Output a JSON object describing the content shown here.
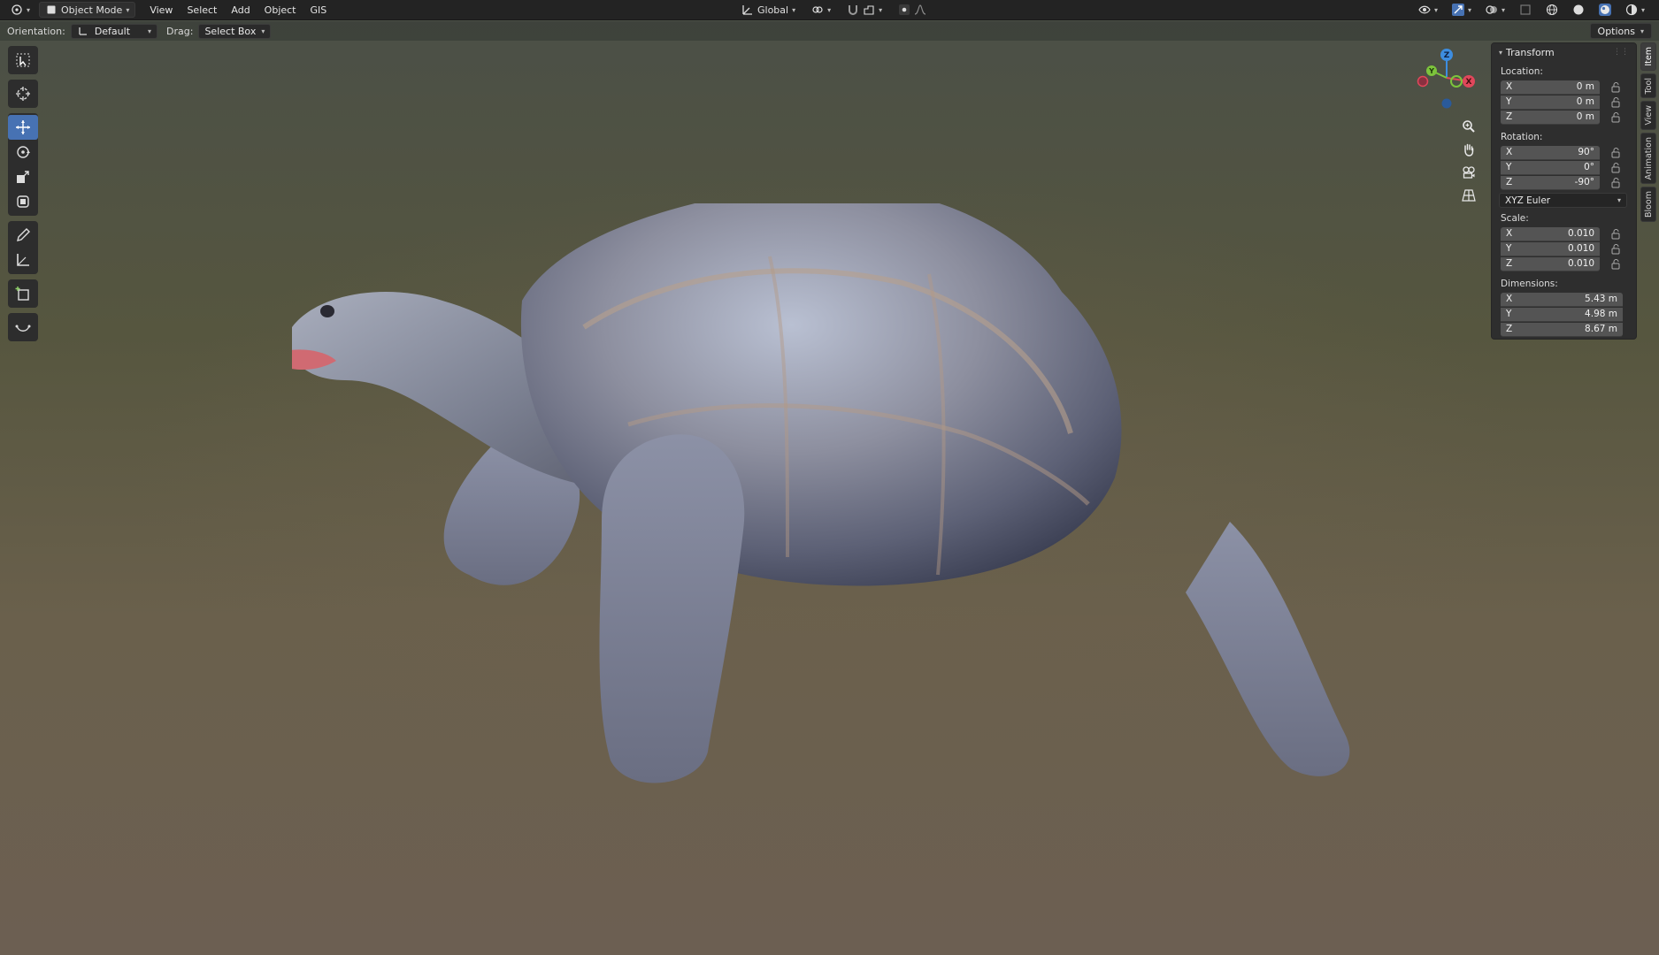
{
  "header": {
    "mode": "Object Mode",
    "menus": [
      "View",
      "Select",
      "Add",
      "Object",
      "GIS"
    ],
    "transform_orientation": "Global"
  },
  "tool_settings": {
    "orientation_label": "Orientation:",
    "orientation_value": "Default",
    "drag_label": "Drag:",
    "drag_value": "Select Box",
    "options_label": "Options"
  },
  "gizmo": {
    "axis_x": "X",
    "axis_y": "Y",
    "axis_z": "Z"
  },
  "transform_panel": {
    "title": "Transform",
    "location": {
      "label": "Location:",
      "rows": [
        {
          "axis": "X",
          "value": "0 m"
        },
        {
          "axis": "Y",
          "value": "0 m"
        },
        {
          "axis": "Z",
          "value": "0 m"
        }
      ]
    },
    "rotation": {
      "label": "Rotation:",
      "rows": [
        {
          "axis": "X",
          "value": "90°"
        },
        {
          "axis": "Y",
          "value": "0°"
        },
        {
          "axis": "Z",
          "value": "-90°"
        }
      ],
      "mode": "XYZ Euler"
    },
    "scale": {
      "label": "Scale:",
      "rows": [
        {
          "axis": "X",
          "value": "0.010"
        },
        {
          "axis": "Y",
          "value": "0.010"
        },
        {
          "axis": "Z",
          "value": "0.010"
        }
      ]
    },
    "dimensions": {
      "label": "Dimensions:",
      "rows": [
        {
          "axis": "X",
          "value": "5.43 m"
        },
        {
          "axis": "Y",
          "value": "4.98 m"
        },
        {
          "axis": "Z",
          "value": "8.67 m"
        }
      ]
    }
  },
  "sidebar_tabs": [
    "Item",
    "Tool",
    "View",
    "Animation",
    "Bloom"
  ],
  "colors": {
    "accent": "#4772b3",
    "axis_x": "#e0475b",
    "axis_y": "#7cc43c",
    "axis_z": "#3d8de0"
  }
}
